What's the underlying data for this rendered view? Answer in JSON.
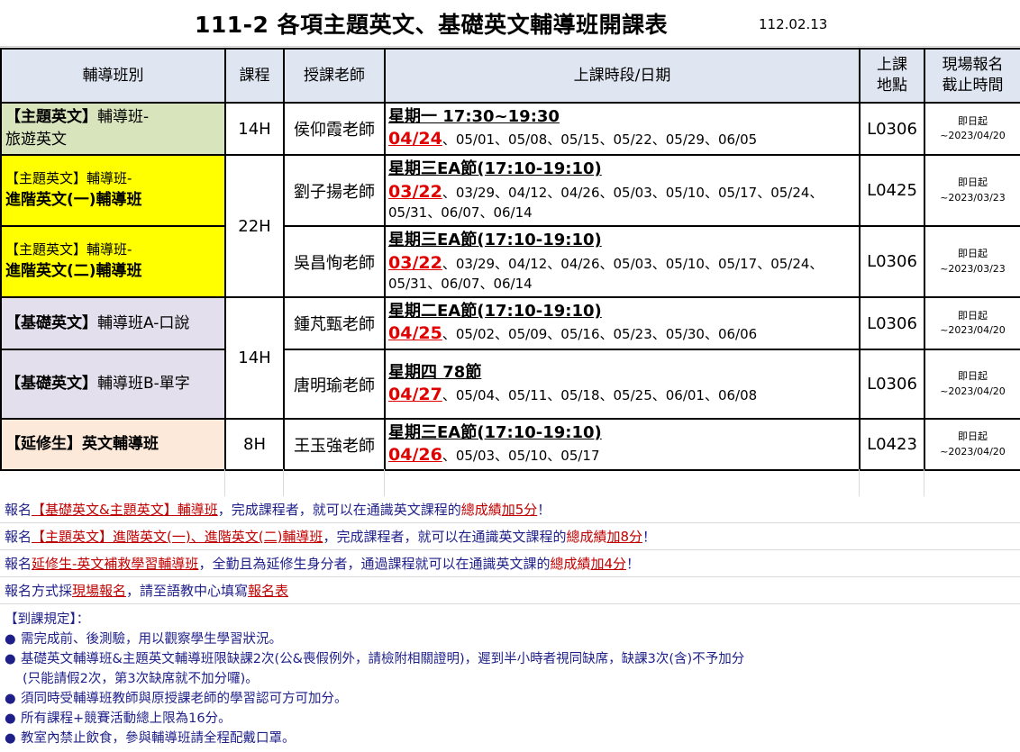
{
  "header": {
    "title": "111-2 各項主題英文、基礎英文輔導班開課表",
    "date": "112.02.13"
  },
  "table": {
    "headers": [
      "輔導班別",
      "課程",
      "授課老師",
      "上課時段/日期",
      "上課地點",
      "現場報名截止時間"
    ],
    "header_loc_line1": "上課",
    "header_loc_line2": "地點",
    "header_dead_line1": "現場報名",
    "header_dead_line2": "截止時間",
    "rows": [
      {
        "class_bold": "【主題英文】",
        "class_rest": "輔導班-",
        "class_line2": "旅遊英文",
        "hours": "14H",
        "teacher": "侯仰霞老師",
        "time": "星期一 17:30~19:30",
        "first_date": "04/24",
        "other_dates": "、05/01、05/08、05/15、05/22、05/29、06/05",
        "location": "L0306",
        "deadline1": "即日起",
        "deadline2": "~2023/04/20"
      },
      {
        "class_rest": "【主題英文】輔導班-",
        "class_line2": "進階英文(一)輔導班",
        "hours": "22H",
        "teacher": "劉子揚老師",
        "time": "星期三EA節(17:10-19:10)",
        "first_date": "03/22",
        "other_dates": "、03/29、04/12、04/26、05/03、05/10、05/17、05/24、05/31、06/07、06/14",
        "location": "L0425",
        "deadline1": "即日起",
        "deadline2": "~2023/03/23"
      },
      {
        "class_rest": "【主題英文】輔導班-",
        "class_line2": "進階英文(二)輔導班",
        "teacher": "吳昌恂老師",
        "time": "星期三EA節(17:10-19:10)",
        "first_date": "03/22",
        "other_dates": "、03/29、04/12、04/26、05/03、05/10、05/17、05/24、05/31、06/07、06/14",
        "location": "L0306",
        "deadline1": "即日起",
        "deadline2": "~2023/03/23"
      },
      {
        "class_bold": "【基礎英文】",
        "class_rest": "輔導班A-口說",
        "hours": "14H",
        "teacher": "鍾芃甄老師",
        "time": "星期二EA節(17:10-19:10)",
        "first_date": "04/25",
        "other_dates": "、05/02、05/09、05/16、05/23、05/30、06/06",
        "location": "L0306",
        "deadline1": "即日起",
        "deadline2": "~2023/04/20"
      },
      {
        "class_bold": "【基礎英文】",
        "class_rest": "輔導班B-單字",
        "teacher": "唐明瑜老師",
        "time": "星期四 78節",
        "first_date": "04/27",
        "other_dates": "、05/04、05/11、05/18、05/25、06/01、06/08",
        "location": "L0306",
        "deadline1": "即日起",
        "deadline2": "~2023/04/20"
      },
      {
        "class_bold": "【延修生】英文輔導班",
        "hours": "8H",
        "teacher": "王玉強老師",
        "time": "星期三EA節(17:10-19:10)",
        "first_date": "04/26",
        "other_dates": "、05/03、05/10、05/17",
        "location": "L0423",
        "deadline1": "即日起",
        "deadline2": "~2023/04/20"
      }
    ]
  },
  "notes": {
    "n1_a": "報名",
    "n1_b": "【基礎英文&主題英文】輔導班",
    "n1_c": "，完成課程者，就可以在通識英文課程的",
    "n1_d": "總成績",
    "n1_e": "加5分",
    "n1_f": "！",
    "n2_a": "報名",
    "n2_b": "【主題英文】進階英文(一)、進階英文(二)輔導班",
    "n2_c": "，完成課程者，就可以在通識英文課程的",
    "n2_d": "總成績",
    "n2_e": "加8分",
    "n2_f": "！",
    "n3_a": "報名",
    "n3_b": "延修生-英文補救學習輔導班",
    "n3_c": "，全勤且為延修生身分者，通過課程就可以在通識英文課的",
    "n3_d": "總成績",
    "n3_e": "加4分",
    "n3_f": "！",
    "n4_a": "報名方式採",
    "n4_b": "現場報名",
    "n4_c": "，請至語教中心填寫",
    "n4_d": "報名表"
  },
  "rules": {
    "heading": "【到課規定】：",
    "bullet": "●",
    "items": [
      "需完成前、後測驗，用以觀察學生學習狀況。",
      "基礎英文輔導班&主題英文輔導班限缺課2次(公&喪假例外，請檢附相關證明)，遲到半小時者視同缺席，缺課3次(含)不予加分",
      "須同時受輔導班教師與原授課老師的學習認可方可加分。",
      "所有課程+競賽活動總上限為16分。",
      "教室內禁止飲食，參與輔導班請全程配戴口罩。"
    ],
    "item2_cont": "(只能請假2次，第3次缺席就不加分囉)。"
  }
}
